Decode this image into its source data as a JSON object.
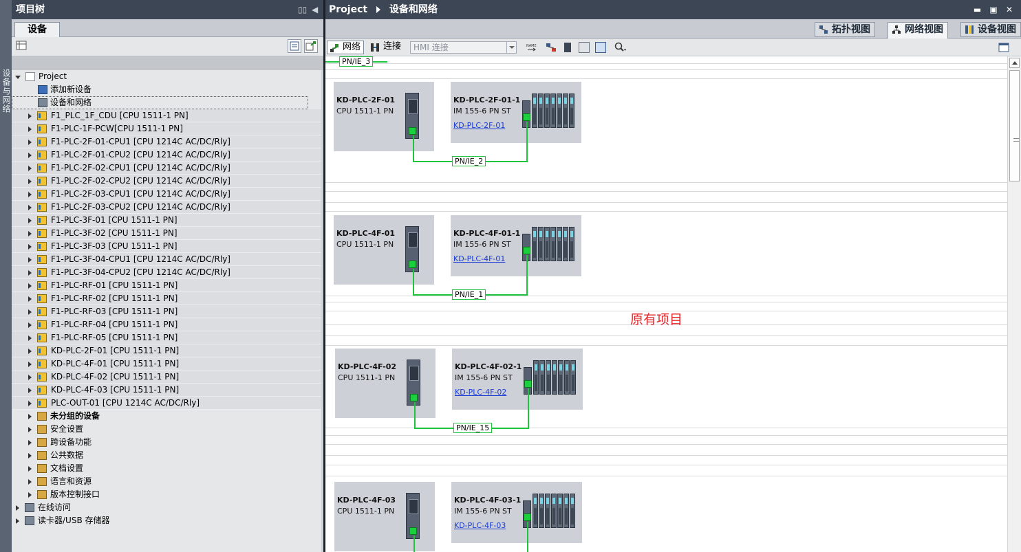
{
  "left_panel": {
    "side_tab": "设备与网络",
    "title": "项目树",
    "tab": "设备",
    "root": "Project",
    "top_items": [
      {
        "label": "添加新设备",
        "icon": "add-device-icon"
      },
      {
        "label": "设备和网络",
        "icon": "devices-networks-icon"
      }
    ],
    "devices": [
      "F1_PLC_1F_CDU [CPU 1511-1 PN]",
      "F1-PLC-1F-PCW[CPU 1511-1 PN]",
      "F1-PLC-2F-01-CPU1 [CPU 1214C AC/DC/Rly]",
      "F1-PLC-2F-01-CPU2 [CPU 1214C AC/DC/Rly]",
      "F1-PLC-2F-02-CPU1 [CPU 1214C AC/DC/Rly]",
      "F1-PLC-2F-02-CPU2 [CPU 1214C AC/DC/Rly]",
      "F1-PLC-2F-03-CPU1 [CPU 1214C AC/DC/Rly]",
      "F1-PLC-2F-03-CPU2 [CPU 1214C AC/DC/Rly]",
      "F1-PLC-3F-01 [CPU 1511-1 PN]",
      "F1-PLC-3F-02 [CPU 1511-1 PN]",
      "F1-PLC-3F-03 [CPU 1511-1 PN]",
      "F1-PLC-3F-04-CPU1 [CPU 1214C AC/DC/Rly]",
      "F1-PLC-3F-04-CPU2 [CPU 1214C AC/DC/Rly]",
      "F1-PLC-RF-01 [CPU 1511-1 PN]",
      "F1-PLC-RF-02 [CPU 1511-1 PN]",
      "F1-PLC-RF-03 [CPU 1511-1 PN]",
      "F1-PLC-RF-04 [CPU 1511-1 PN]",
      "F1-PLC-RF-05 [CPU 1511-1 PN]",
      "KD-PLC-2F-01 [CPU 1511-1 PN]",
      "KD-PLC-4F-01 [CPU 1511-1 PN]",
      "KD-PLC-4F-02 [CPU 1511-1 PN]",
      "KD-PLC-4F-03 [CPU 1511-1 PN]",
      "PLC-OUT-01 [CPU 1214C AC/DC/Rly]"
    ],
    "folders": [
      {
        "label": "未分组的设备",
        "bold": true
      },
      {
        "label": "安全设置"
      },
      {
        "label": "跨设备功能"
      },
      {
        "label": "公共数据"
      },
      {
        "label": "文档设置"
      },
      {
        "label": "语言和资源"
      },
      {
        "label": "版本控制接口"
      }
    ],
    "root_level": [
      "在线访问",
      "读卡器/USB 存储器"
    ]
  },
  "right_panel": {
    "breadcrumb": [
      "Project",
      "设备和网络"
    ],
    "view_tabs": [
      {
        "label": "拓扑视图",
        "active": false
      },
      {
        "label": "网络视图",
        "active": true
      },
      {
        "label": "设备视图",
        "active": false
      }
    ],
    "toolbar": {
      "network": "网络",
      "connections": "连接",
      "hmi_connection": "HMI 连接"
    },
    "top_network": "PN/IE_3",
    "annotation": "原有项目",
    "groups": [
      {
        "plc_name": "KD-PLC-2F-01",
        "plc_type": "CPU 1511-1 PN",
        "io_name": "KD-PLC-2F-01-1",
        "io_type": "IM 155-6 PN ST",
        "io_link": "KD-PLC-2F-01",
        "subnet": "PN/IE_2"
      },
      {
        "plc_name": "KD-PLC-4F-01",
        "plc_type": "CPU 1511-1 PN",
        "io_name": "KD-PLC-4F-01-1",
        "io_type": "IM 155-6 PN ST",
        "io_link": "KD-PLC-4F-01",
        "subnet": "PN/IE_1"
      },
      {
        "plc_name": "KD-PLC-4F-02",
        "plc_type": "CPU 1511-1 PN",
        "io_name": "KD-PLC-4F-02-1",
        "io_type": "IM 155-6 PN ST",
        "io_link": "KD-PLC-4F-02",
        "subnet": "PN/IE_15"
      },
      {
        "plc_name": "KD-PLC-4F-03",
        "plc_type": "CPU 1511-1 PN",
        "io_name": "KD-PLC-4F-03-1",
        "io_type": "IM 155-6 PN ST",
        "io_link": "KD-PLC-4F-03",
        "subnet": ""
      }
    ]
  },
  "colors": {
    "title_bar": "#3d4655",
    "network_wire": "#1fc33c",
    "annotation": "#e0262a",
    "link": "#1a3bd6"
  }
}
